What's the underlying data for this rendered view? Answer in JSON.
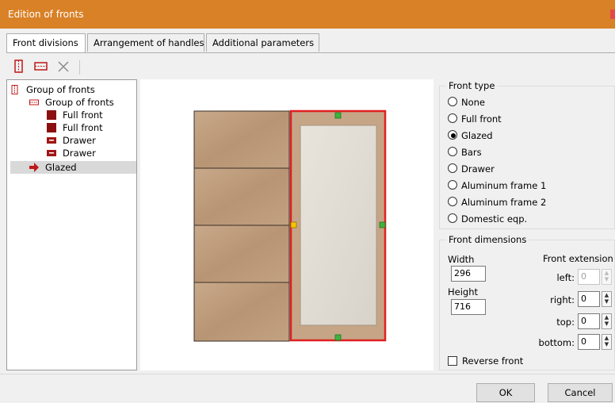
{
  "window": {
    "title": "Edition of fronts"
  },
  "tabs": [
    "Front divisions",
    "Arrangement of handles",
    "Additional parameters"
  ],
  "toolbar": {
    "icons": [
      "add-vertical-division-icon",
      "add-horizontal-division-icon",
      "delete-icon"
    ]
  },
  "tree": {
    "items": [
      {
        "label": "Group of fronts",
        "icon": "vertical-group-icon",
        "level": 0
      },
      {
        "label": "Group of fronts",
        "icon": "horizontal-group-icon",
        "level": 1
      },
      {
        "label": "Full front",
        "icon": "full-front-icon",
        "level": 2
      },
      {
        "label": "Full front",
        "icon": "full-front-icon",
        "level": 2
      },
      {
        "label": "Drawer",
        "icon": "drawer-icon",
        "level": 2
      },
      {
        "label": "Drawer",
        "icon": "drawer-icon",
        "level": 2
      },
      {
        "label": "Glazed",
        "icon": "arrow-icon",
        "level": 1,
        "selected": true
      }
    ]
  },
  "front_type": {
    "title": "Front type",
    "options": [
      "None",
      "Full front",
      "Glazed",
      "Bars",
      "Drawer",
      "Aluminum frame 1",
      "Aluminum frame 2",
      "Domestic eqp."
    ],
    "selected": "Glazed"
  },
  "front_dimensions": {
    "title": "Front dimensions",
    "width_label": "Width",
    "width_value": "296",
    "height_label": "Height",
    "height_value": "716"
  },
  "front_extension": {
    "title": "Front extension",
    "left_label": "left:",
    "left_value": "0",
    "right_label": "right:",
    "right_value": "0",
    "top_label": "top:",
    "top_value": "0",
    "bottom_label": "bottom:",
    "bottom_value": "0"
  },
  "reverse_front": {
    "label": "Reverse front",
    "checked": false
  },
  "buttons": {
    "ok": "OK",
    "cancel": "Cancel"
  },
  "colors": {
    "titlebar": "#d98127",
    "selection_outline": "#e02020",
    "handle_green": "#3cb43c",
    "handle_yellow": "#f5c400"
  }
}
